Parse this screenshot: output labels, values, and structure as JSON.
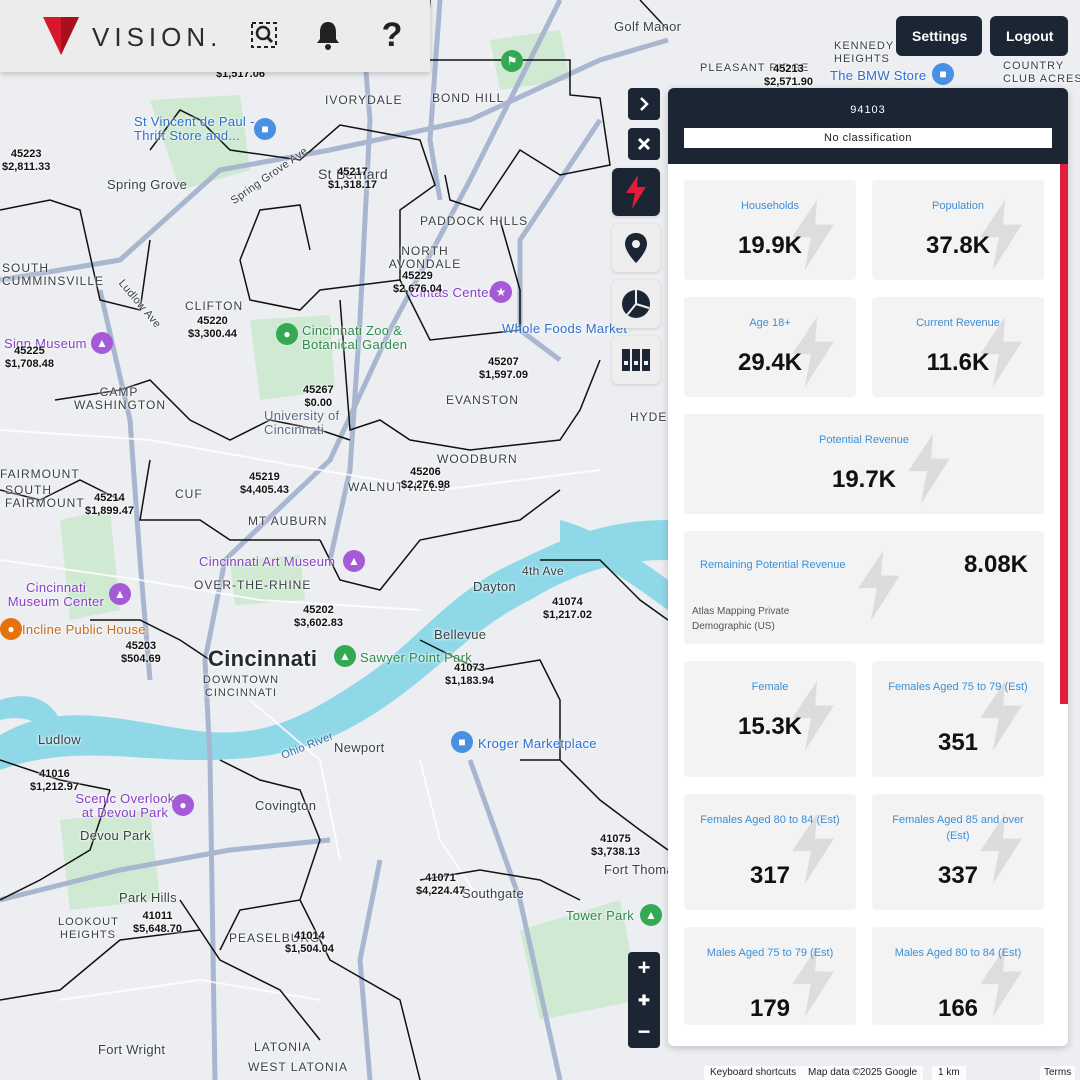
{
  "app": {
    "logo_text": "VISION.",
    "brand_color": "#d7182a",
    "navy": "#1c2533"
  },
  "header": {
    "settings_label": "Settings",
    "logout_label": "Logout"
  },
  "toolbar_icons": [
    "zip-search-icon",
    "bell-icon",
    "help-icon"
  ],
  "help_glyph": "?",
  "panel": {
    "zip": "94103",
    "classification": "No classification",
    "cards": [
      {
        "label": "Households",
        "value": "19.9K"
      },
      {
        "label": "Population",
        "value": "37.8K"
      },
      {
        "label": "Age 18+",
        "value": "29.4K"
      },
      {
        "label": "Current Revenue",
        "value": "11.6K"
      },
      {
        "label": "Potential Revenue",
        "value": "19.7K"
      },
      {
        "label": "Remaining Potential Revenue",
        "value": "8.08K",
        "source": "Atlas Mapping Private Demographic (US)"
      },
      {
        "label": "Female",
        "value": "15.3K"
      },
      {
        "label": "Females Aged 75 to 79 (Est)",
        "value": "351"
      },
      {
        "label": "Females Aged 80 to 84 (Est)",
        "value": "317"
      },
      {
        "label": "Females Aged 85 and over (Est)",
        "value": "337"
      },
      {
        "label": "Males Aged 75 to 79 (Est)",
        "value": "179"
      },
      {
        "label": "Males Aged 80 to 84 (Est)",
        "value": "166"
      }
    ]
  },
  "map": {
    "places": [
      {
        "t": "Golf Manor"
      },
      {
        "t": "PLEASANT RIDGE"
      },
      {
        "t": "KENNEDY HEIGHTS"
      },
      {
        "t": "The BMW Store"
      },
      {
        "t": "COUNTRY CLUB ACRES"
      },
      {
        "t": "BOND HILL"
      },
      {
        "t": "IVORYDALE"
      },
      {
        "t": "St Vincent de Paul - Thrift Store and..."
      },
      {
        "t": "Spring Grove"
      },
      {
        "t": "St Bernard"
      },
      {
        "t": "PADDOCK HILLS"
      },
      {
        "t": "NORTH AVONDALE"
      },
      {
        "t": "Cintas Center"
      },
      {
        "t": "SOUTH CUMMINSVILLE"
      },
      {
        "t": "CLIFTON"
      },
      {
        "t": "Whole Foods Market"
      },
      {
        "t": "Cincinnati Zoo & Botanical Garden"
      },
      {
        "t": "Sign Museum"
      },
      {
        "t": "CAMP WASHINGTON"
      },
      {
        "t": "EVANSTON"
      },
      {
        "t": "HYDE"
      },
      {
        "t": "University of Cincinnati"
      },
      {
        "t": "WOODBURN"
      },
      {
        "t": "FAIRMOUNT"
      },
      {
        "t": "SOUTH FAIRMOUNT"
      },
      {
        "t": "CUF"
      },
      {
        "t": "WALNUT HILLS"
      },
      {
        "t": "MT AUBURN"
      },
      {
        "t": "Cincinnati Art Museum"
      },
      {
        "t": "OVER-THE-RHINE"
      },
      {
        "t": "Dayton"
      },
      {
        "t": "Cincinnati Museum Center"
      },
      {
        "t": "Incline Public House"
      },
      {
        "t": "Bellevue"
      },
      {
        "t": "Cincinnati"
      },
      {
        "t": "Sawyer Point Park"
      },
      {
        "t": "DOWNTOWN CINCINNATI"
      },
      {
        "t": "Ludlow"
      },
      {
        "t": "Newport"
      },
      {
        "t": "Kroger Marketplace"
      },
      {
        "t": "Scenic Overlook at Devou Park"
      },
      {
        "t": "Covington"
      },
      {
        "t": "Devou Park"
      },
      {
        "t": "Fort Thomas"
      },
      {
        "t": "Park Hills"
      },
      {
        "t": "Southgate"
      },
      {
        "t": "Tower Park"
      },
      {
        "t": "LOOKOUT HEIGHTS"
      },
      {
        "t": "PEASELBURG"
      },
      {
        "t": "Fort Wright"
      },
      {
        "t": "LATONIA"
      },
      {
        "t": "WEST LATONIA"
      },
      {
        "t": "Ohio River"
      },
      {
        "t": "4th Ave"
      },
      {
        "t": "Ludlow Ave"
      },
      {
        "t": "Spring Grove Ave"
      }
    ],
    "zips": [
      {
        "zip": "45213",
        "amt": "$2,571.90"
      },
      {
        "zip": "45223",
        "amt": "$2,811.33"
      },
      {
        "zip": "45217",
        "amt": "$1,318.17"
      },
      {
        "zip": "45229",
        "amt": "$2,676.04"
      },
      {
        "zip": "45220",
        "amt": "$3,300.44"
      },
      {
        "zip": "45225",
        "amt": "$1,708.48"
      },
      {
        "zip": "45207",
        "amt": "$1,597.09"
      },
      {
        "zip": "45267",
        "amt": "$0.00"
      },
      {
        "zip": "45219",
        "amt": "$4,405.43"
      },
      {
        "zip": "45206",
        "amt": "$2,276.98"
      },
      {
        "zip": "45214",
        "amt": "$1,899.47"
      },
      {
        "zip": "41074",
        "amt": "$1,217.02"
      },
      {
        "zip": "45202",
        "amt": "$3,602.83"
      },
      {
        "zip": "45203",
        "amt": "$504.69"
      },
      {
        "zip": "41073",
        "amt": "$1,183.94"
      },
      {
        "zip": "41016",
        "amt": "$1,212.97"
      },
      {
        "zip": "41075",
        "amt": "$3,738.13"
      },
      {
        "zip": "41071",
        "amt": "$4,224.47"
      },
      {
        "zip": "41011",
        "amt": "$5,648.70"
      },
      {
        "zip": "41014",
        "amt": "$1,504.04"
      },
      {
        "zip": "",
        "amt": "$1,517.06"
      }
    ],
    "attribution": {
      "shortcuts": "Keyboard shortcuts",
      "mapdata": "Map data ©2025 Google",
      "scale": "1 km",
      "terms": "Terms"
    }
  }
}
